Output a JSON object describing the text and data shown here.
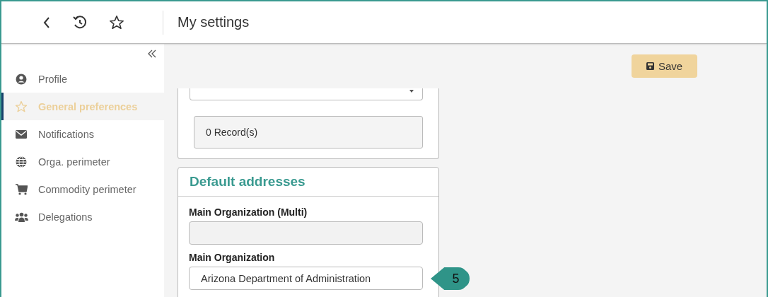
{
  "header": {
    "title": "My settings"
  },
  "sidebar": {
    "items": [
      {
        "label": "Profile",
        "selected": false
      },
      {
        "label": "General preferences",
        "selected": true
      },
      {
        "label": "Notifications",
        "selected": false
      },
      {
        "label": "Orga. perimeter",
        "selected": false
      },
      {
        "label": "Commodity perimeter",
        "selected": false
      },
      {
        "label": "Delegations",
        "selected": false
      }
    ]
  },
  "toolbar": {
    "save": "Save"
  },
  "records_card": {
    "records": "0 Record(s)"
  },
  "addresses_card": {
    "title": "Default addresses",
    "fields": [
      {
        "label": "Main Organization (Multi)",
        "disabled": true
      },
      {
        "label": "Main Organization",
        "value": "Arizona Department of Administration",
        "disabled": false
      }
    ]
  },
  "callout": {
    "number": "5"
  }
}
